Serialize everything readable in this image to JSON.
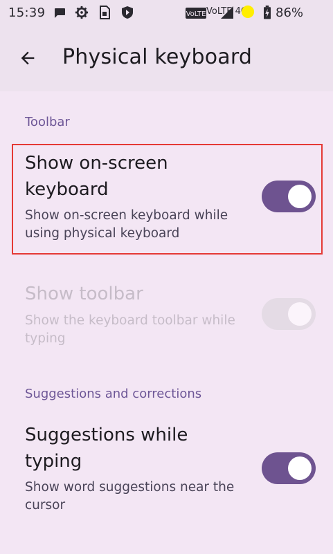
{
  "status_bar": {
    "time": "15:39",
    "network_label": "VoLTE 4G",
    "battery_percent": "86%",
    "icons": [
      "message-icon",
      "settings-gear-icon",
      "sim-icon",
      "shield-icon",
      "volte-icon",
      "signal-icon",
      "notification-dot-icon",
      "battery-icon"
    ]
  },
  "app_bar": {
    "title": "Physical keyboard",
    "back_icon": "arrow-back-icon"
  },
  "sections": {
    "toolbar": {
      "header": "Toolbar",
      "items": [
        {
          "title": "Show on-screen keyboard",
          "summary": "Show on-screen keyboard while using physical keyboard",
          "enabled": true,
          "checked": true
        },
        {
          "title": "Show toolbar",
          "summary": "Show the keyboard toolbar while typing",
          "enabled": false,
          "checked": false
        }
      ]
    },
    "suggestions": {
      "header": "Suggestions and corrections",
      "items": [
        {
          "title": "Suggestions while typing",
          "summary": "Show word suggestions near the cursor",
          "enabled": true,
          "checked": true
        }
      ]
    }
  },
  "colors": {
    "background": "#f3e6f4",
    "app_bar": "#ede2ee",
    "accent": "#6e5390",
    "section_header": "#6e5797",
    "highlight": "#e53935"
  }
}
